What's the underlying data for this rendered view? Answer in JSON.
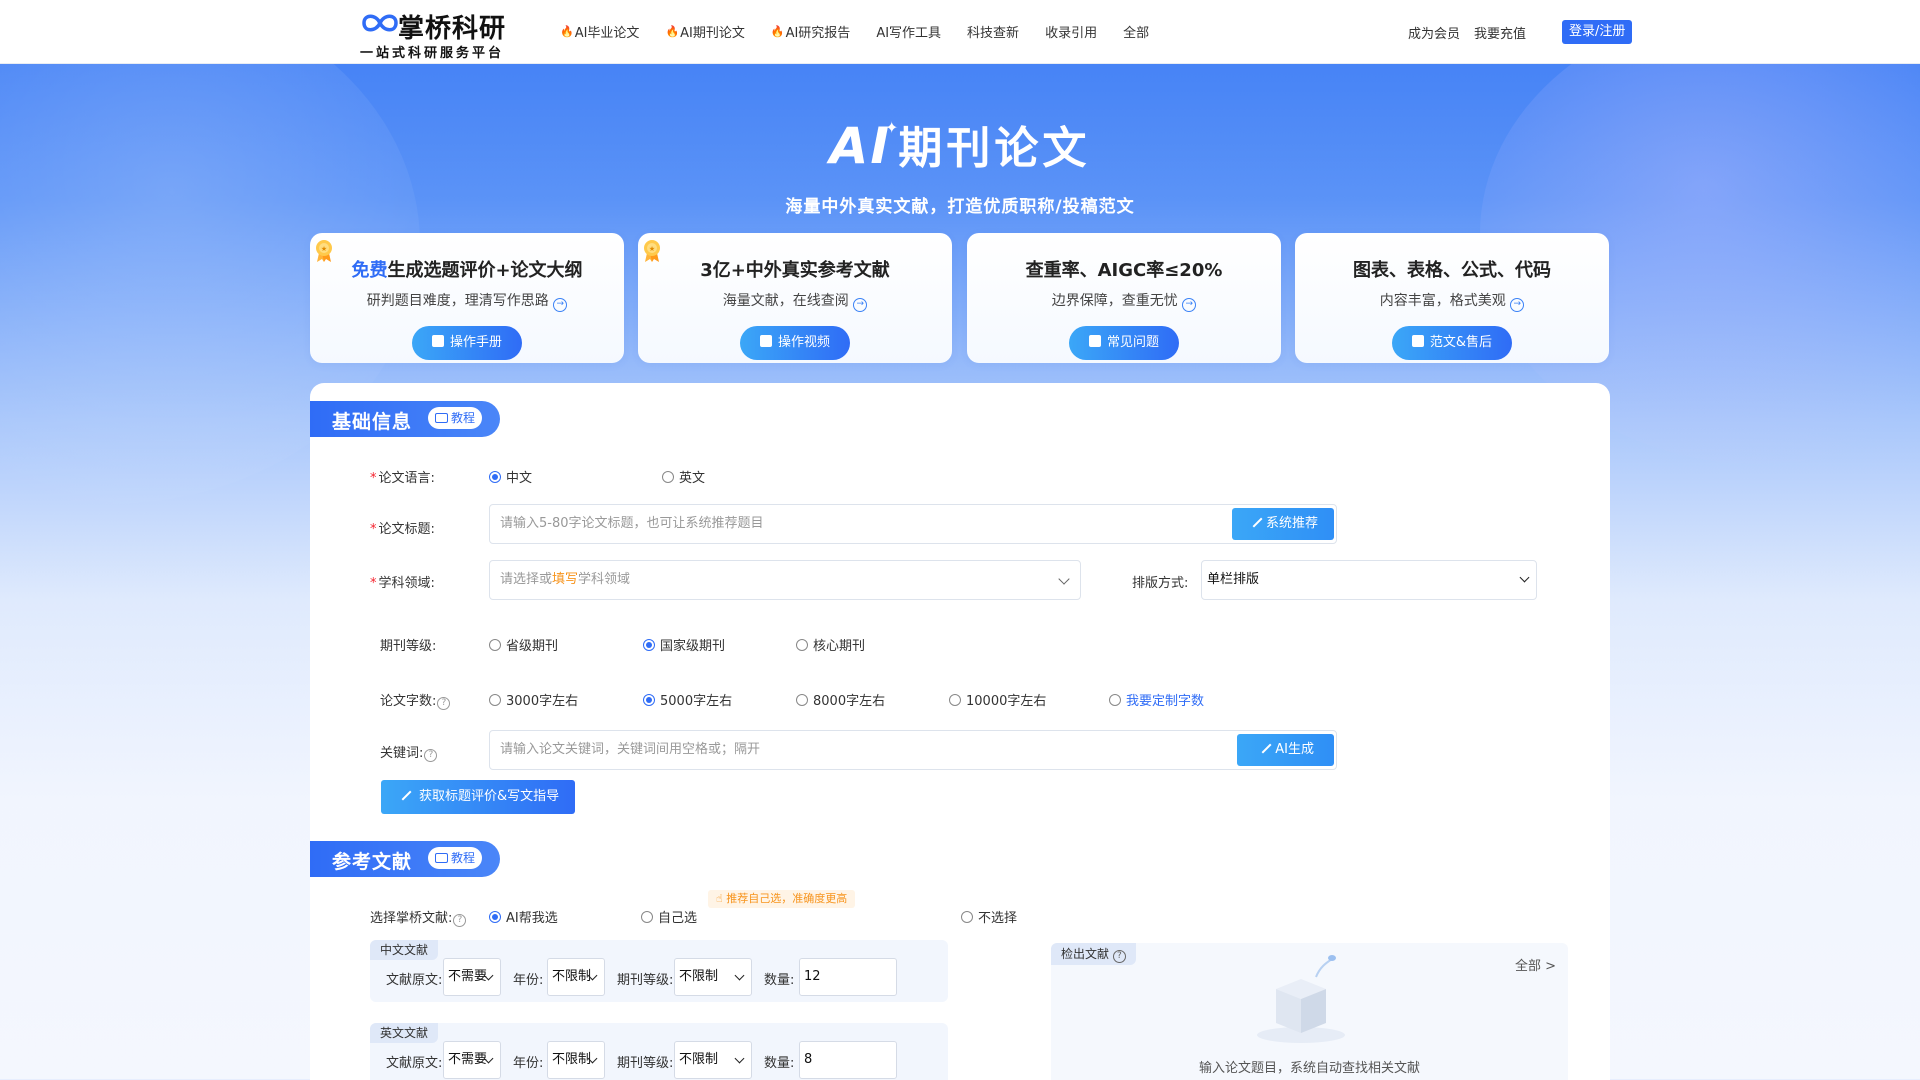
{
  "header": {
    "logo_name": "掌桥科研",
    "logo_slogan": "一站式科研服务平台",
    "nav": [
      {
        "label": "AI毕业论文",
        "hot": true
      },
      {
        "label": "AI期刊论文",
        "hot": true
      },
      {
        "label": "AI研究报告",
        "hot": true
      },
      {
        "label": "AI写作工具",
        "hot": false
      },
      {
        "label": "科技查新",
        "hot": false
      },
      {
        "label": "收录引用",
        "hot": false
      },
      {
        "label": "全部",
        "hot": false
      }
    ],
    "member": "成为会员",
    "recharge": "我要充值",
    "login": "登录/注册"
  },
  "hero": {
    "ai": "AI",
    "title": "期刊论文",
    "subtitle": "海量中外真实文献，打造优质职称/投稿范文"
  },
  "cards": [
    {
      "highlight": "免费",
      "title": "生成选题评价+论文大纲",
      "sub": "研判题目难度，理清写作思路",
      "btn": "操作手册",
      "medal": true
    },
    {
      "highlight": "",
      "title": "3亿+中外真实参考文献",
      "sub": "海量文献，在线查阅",
      "btn": "操作视频",
      "medal": true
    },
    {
      "highlight": "",
      "title": "查重率、AIGC率≤20%",
      "sub": "边界保障，查重无忧",
      "btn": "常见问题",
      "medal": false
    },
    {
      "highlight": "",
      "title": "图表、表格、公式、代码",
      "sub": "内容丰富，格式美观",
      "btn": "范文&售后",
      "medal": false
    }
  ],
  "basic": {
    "section_title": "基础信息",
    "tutorial": "教程",
    "lang_label": "论文语言:",
    "lang_options": [
      "中文",
      "英文"
    ],
    "lang_selected": 0,
    "title_label": "论文标题:",
    "title_placeholder": "请输入5-80字论文标题，也可让系统推荐题目",
    "recommend_btn": "系统推荐",
    "field_label": "学科领域:",
    "field_placeholder_a": "请选择或",
    "field_placeholder_b": "填写",
    "field_placeholder_c": "学科领域",
    "layout_label": "排版方式:",
    "layout_value": "单栏排版",
    "level_label": "期刊等级:",
    "level_options": [
      "省级期刊",
      "国家级期刊",
      "核心期刊"
    ],
    "level_selected": 1,
    "words_label": "论文字数:",
    "words_options": [
      "3000字左右",
      "5000字左右",
      "8000字左右",
      "10000字左右",
      "我要定制字数"
    ],
    "words_selected": 1,
    "kw_label": "关键词:",
    "kw_placeholder": "请输入论文关键词，关键词间用空格或；隔开",
    "ai_gen_btn": "AI生成",
    "get_btn": "获取标题评价&写文指导"
  },
  "refs": {
    "section_title": "参考文献",
    "tutorial": "教程",
    "choose_label": "选择掌桥文献:",
    "choose_options": [
      "AI帮我选",
      "自己选",
      "不选择"
    ],
    "choose_selected": 0,
    "tip": "推荐自己选，准确度更高",
    "cn_tag": "中文文献",
    "en_tag": "英文文献",
    "orig_label": "文献原文:",
    "orig_value": "不需要",
    "year_label": "年份:",
    "year_value": "不限制",
    "jlevel_label": "期刊等级:",
    "jlevel_value": "不限制",
    "qty_label": "数量:",
    "cn_qty": "12",
    "en_qty": "8",
    "result_tag": "检出文献",
    "all_link": "全部 >",
    "empty_text": "输入论文题目，系统自动查找相关文献"
  }
}
